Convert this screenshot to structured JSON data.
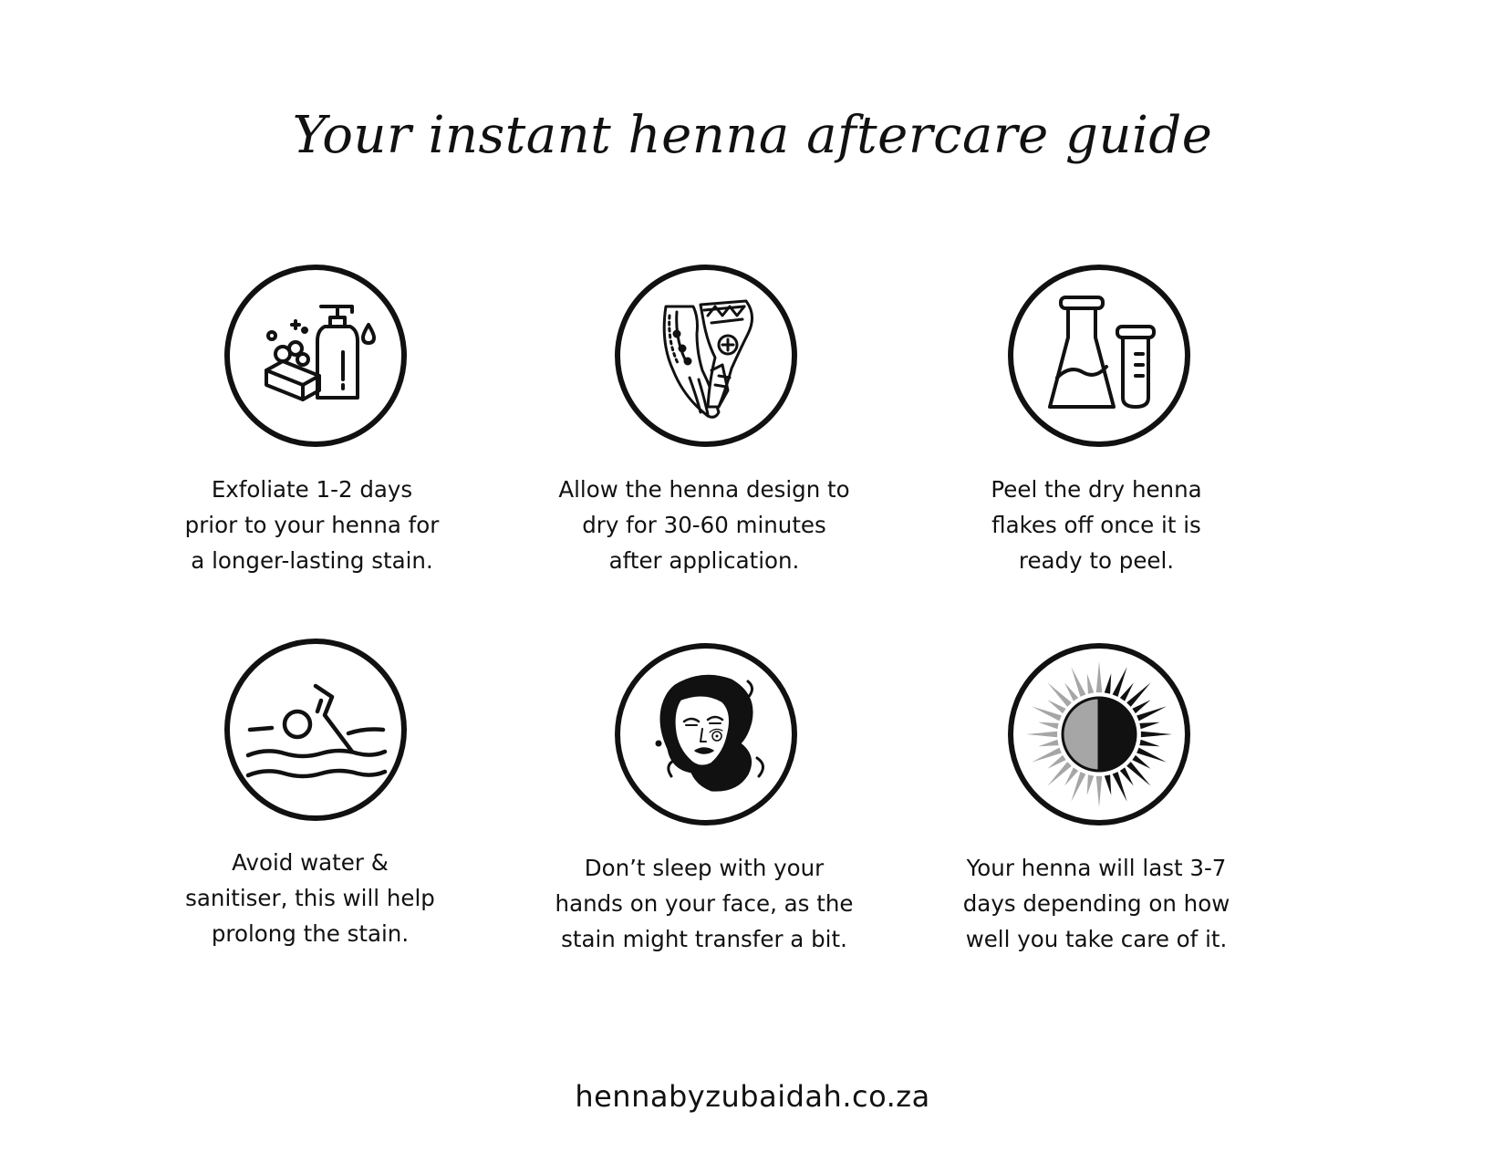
{
  "title": "Your instant henna aftercare guide",
  "tips": [
    {
      "icon": "soap-bottle-icon",
      "lines": [
        "Exfoliate 1-2 days",
        "prior to your henna for",
        "a longer-lasting stain."
      ]
    },
    {
      "icon": "henna-hand-icon",
      "lines": [
        "Allow the henna design to",
        "dry for 30-60 minutes",
        "after application."
      ]
    },
    {
      "icon": "flask-test-tube-icon",
      "lines": [
        "Peel the dry henna",
        "flakes off once it is",
        "ready to peel."
      ]
    },
    {
      "icon": "swimmer-icon",
      "lines": [
        "Avoid water &",
        "sanitiser, this will help",
        "prolong the stain."
      ]
    },
    {
      "icon": "woman-face-icon",
      "lines": [
        "Don’t sleep with your",
        "hands on your face, as the",
        "stain might transfer a bit."
      ]
    },
    {
      "icon": "half-sun-icon",
      "lines": [
        "Your henna will last 3-7",
        "days depending on how",
        "well you take care of it."
      ]
    }
  ],
  "footer": "hennabyzubaidah.co.za",
  "colors": {
    "ink": "#111111",
    "background": "#ffffff",
    "sun_grey": "#a6a6a6"
  }
}
